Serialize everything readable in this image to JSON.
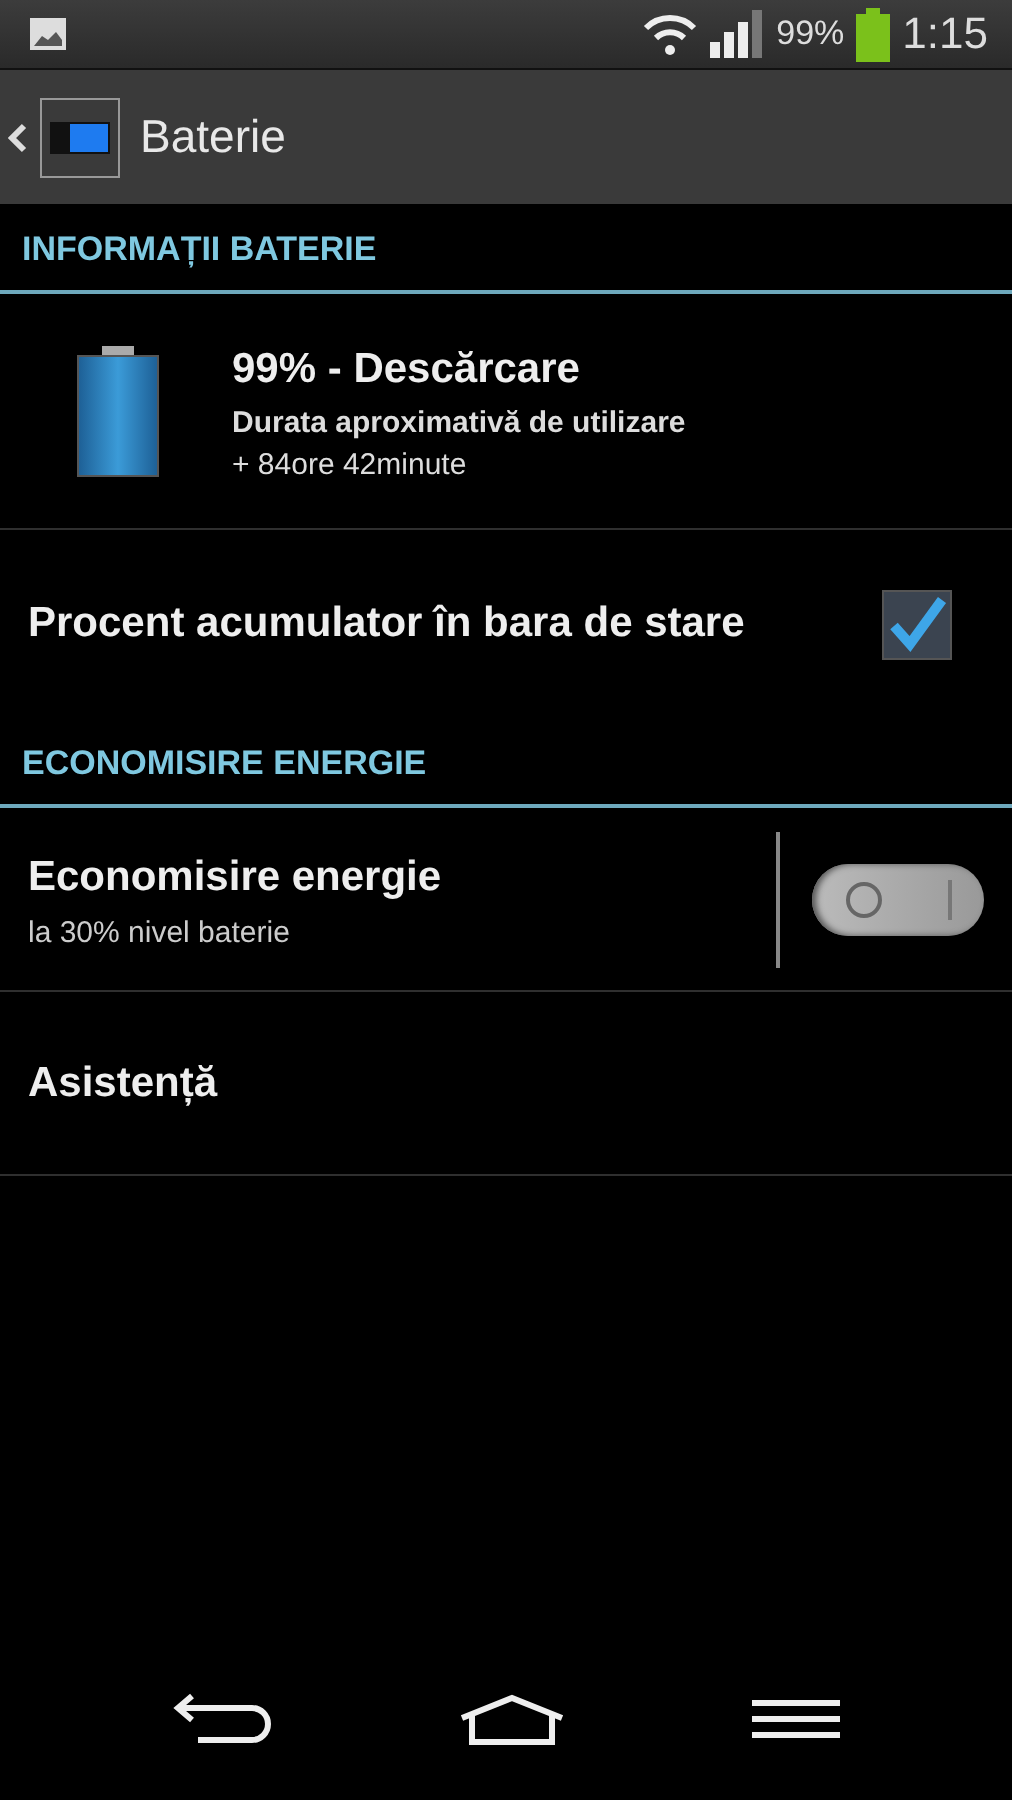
{
  "status_bar": {
    "battery": "99%",
    "time": "1:15"
  },
  "action_bar": {
    "title": "Baterie"
  },
  "sections": [
    {
      "header": "INFORMAȚII BATERIE",
      "items": [
        {
          "kind": "battery_info",
          "title": "99% - Descărcare",
          "subtitle": "Durata aproximativă de utilizare",
          "detail": "+ 84ore 42minute"
        },
        {
          "kind": "checkbox",
          "title": "Procent acumulator în bara de stare",
          "checked": true
        }
      ]
    },
    {
      "header": "ECONOMISIRE ENERGIE",
      "items": [
        {
          "kind": "switch",
          "title": "Economisire energie",
          "subtitle": "la  30% nivel baterie",
          "on": false
        },
        {
          "kind": "plain",
          "title": "Asistență"
        }
      ]
    }
  ]
}
